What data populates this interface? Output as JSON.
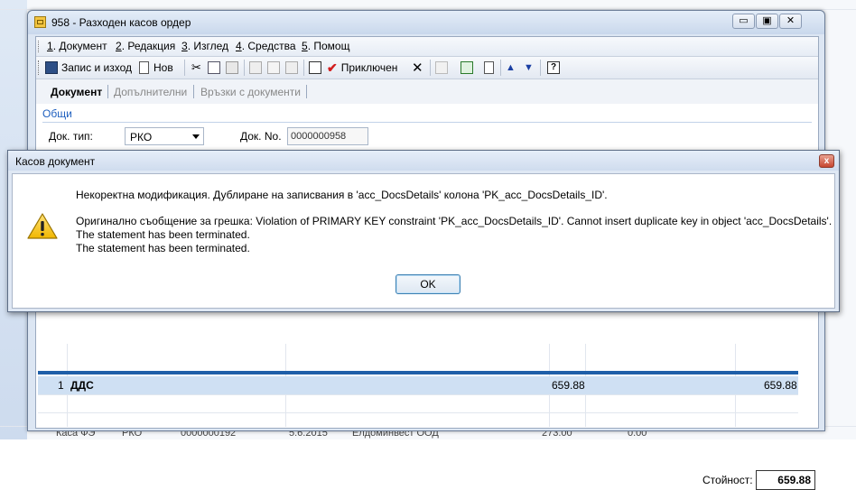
{
  "background": {
    "bottom_row": {
      "name": "Каса ФЭ",
      "type": "РКО",
      "number": "0000000192",
      "date": "5.6.2015",
      "partner": "Елдоминвест ООД",
      "amount1": "273.00",
      "amount2": "0.00"
    }
  },
  "window": {
    "title": "958 - Разходен касов ордер",
    "controls": {
      "minimize": "▭",
      "restore": "▣",
      "close": "✕"
    }
  },
  "menu": [
    {
      "key": "1",
      "label": ". Документ"
    },
    {
      "key": "2",
      "label": ". Редакция"
    },
    {
      "key": "3",
      "label": ". Изглед"
    },
    {
      "key": "4",
      "label": ". Средства"
    },
    {
      "key": "5",
      "label": ". Помощ"
    }
  ],
  "toolbar": {
    "save_exit": "Запис и изход",
    "new": "Нов",
    "completed": "Приключен"
  },
  "tabs": [
    {
      "label": "Документ",
      "active": true
    },
    {
      "label": "Допълнителни",
      "active": false
    },
    {
      "label": "Връзки с документи",
      "active": false
    }
  ],
  "form": {
    "group": "Общи",
    "doc_type_label": "Док. тип:",
    "doc_type_value": "РКО",
    "doc_no_label": "Док. No.",
    "doc_no_value": "0000000958"
  },
  "grid": {
    "row": {
      "index": "1",
      "name": "ДДС",
      "amount1": "659.88",
      "amount2": "659.88"
    }
  },
  "total": {
    "label": "Стойност:",
    "value": "659.88"
  },
  "dialog": {
    "title": "Касов документ",
    "close": "x",
    "line1": "Некоректна модификация. Дублиране на записвания в 'acc_DocsDetails' колона 'PK_acc_DocsDetails_ID'.",
    "line2": "Оригинално съобщение за грешка: Violation of PRIMARY KEY constraint 'PK_acc_DocsDetails_ID'. Cannot insert duplicate key in object 'acc_DocsDetails'.",
    "line3": "The statement has been terminated.",
    "line4": "The statement has been terminated.",
    "ok": "OK"
  },
  "colors": {
    "accent": "#1f5fa8",
    "selection": "#cfe0f3",
    "group_label": "#1e5fbf"
  }
}
